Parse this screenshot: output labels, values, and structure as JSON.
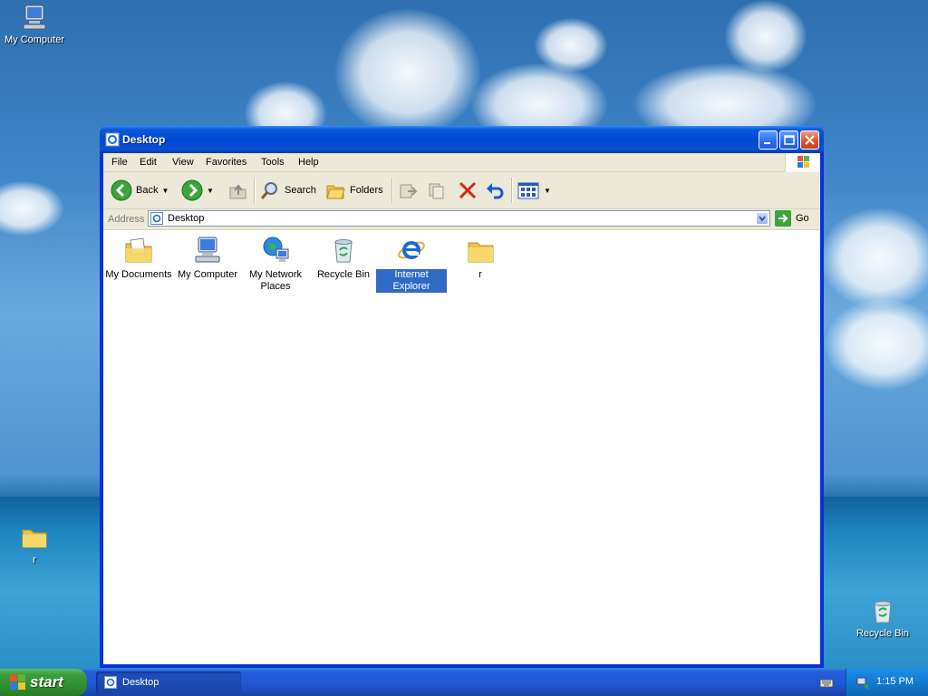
{
  "desktop": {
    "icons": [
      {
        "label": "My Computer",
        "icon": "my-computer-icon"
      },
      {
        "label": "r",
        "icon": "folder-icon"
      },
      {
        "label": "Recycle Bin",
        "icon": "recycle-bin-icon"
      }
    ]
  },
  "window": {
    "title": "Desktop",
    "menu": [
      "File",
      "Edit",
      "View",
      "Favorites",
      "Tools",
      "Help"
    ],
    "toolbar": {
      "back_label": "Back",
      "search_label": "Search",
      "folders_label": "Folders"
    },
    "address": {
      "label": "Address",
      "value": "Desktop",
      "go_label": "Go"
    },
    "items": [
      {
        "label": "My Documents",
        "icon": "my-documents-icon",
        "selected": false
      },
      {
        "label": "My Computer",
        "icon": "my-computer-icon",
        "selected": false
      },
      {
        "label": "My Network Places",
        "icon": "my-network-places-icon",
        "selected": false
      },
      {
        "label": "Recycle Bin",
        "icon": "recycle-bin-icon",
        "selected": false
      },
      {
        "label": "Internet Explorer",
        "icon": "internet-explorer-icon",
        "selected": true
      },
      {
        "label": "r",
        "icon": "folder-icon",
        "selected": false
      }
    ]
  },
  "taskbar": {
    "start_label": "start",
    "task_label": "Desktop",
    "clock": "1:15 PM"
  },
  "colors": {
    "title_blue": "#0a4fd0",
    "selection": "#316ac5",
    "start_green": "#3c9e3c"
  }
}
